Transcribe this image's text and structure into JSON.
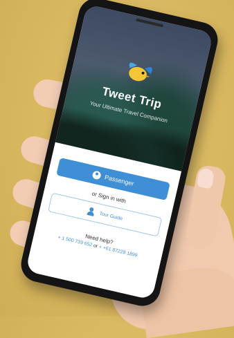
{
  "app": {
    "title": "Tweet Trip",
    "tagline": "Your Ultimate Travel Companion"
  },
  "actions": {
    "primary_label": "Passenger",
    "or_label": "or Sign in with",
    "secondary_label": "Tour Guide"
  },
  "help": {
    "label": "Need help?",
    "phone_1": "+ 1 500 739 652",
    "or_word": "or",
    "phone_2": "+ +61 87228 1899"
  },
  "colors": {
    "accent": "#3f8fd6",
    "background": "#d8b75f"
  },
  "icons": {
    "logo": "bird-logo-icon",
    "primary": "user-icon",
    "secondary": "tour-guide-icon"
  }
}
